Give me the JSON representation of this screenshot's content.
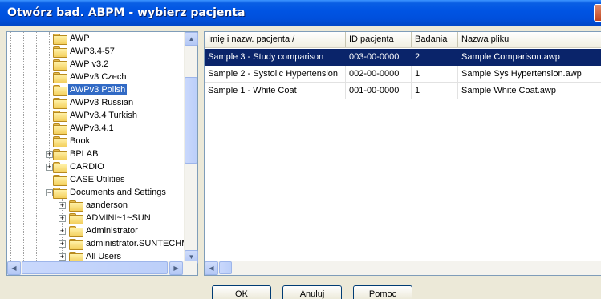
{
  "window": {
    "title": "Otwórz bad. ABPM - wybierz pacjenta"
  },
  "tree": {
    "items": [
      {
        "label": "AWP"
      },
      {
        "label": "AWP3.4-57"
      },
      {
        "label": "AWP v3.2"
      },
      {
        "label": "AWPv3 Czech"
      },
      {
        "label": "AWPv3 Polish",
        "selected": true
      },
      {
        "label": "AWPv3 Russian"
      },
      {
        "label": "AWPv3.4 Turkish"
      },
      {
        "label": "AWPv3.4.1"
      },
      {
        "label": "Book"
      },
      {
        "label": "BPLAB"
      },
      {
        "label": "CARDIO"
      },
      {
        "label": "CASE Utilities"
      },
      {
        "label": "Documents and Settings"
      },
      {
        "label": "aanderson"
      },
      {
        "label": "ADMINI~1~SUN"
      },
      {
        "label": "Administrator"
      },
      {
        "label": "administrator.SUNTECHM"
      },
      {
        "label": "All Users"
      }
    ],
    "expanders": {
      "plus": "+",
      "minus": "−"
    }
  },
  "list": {
    "columns": [
      "Imię i nazw. pacjenta /",
      "ID pacjenta",
      "Badania",
      "Nazwa pliku"
    ],
    "rows": [
      [
        "Sample 3 - Study comparison",
        "003-00-0000",
        "2",
        "Sample Comparison.awp"
      ],
      [
        "Sample 2 - Systolic Hypertension",
        "002-00-0000",
        "1",
        "Sample Sys Hypertension.awp"
      ],
      [
        "Sample 1 - White Coat",
        "001-00-0000",
        "1",
        "Sample White Coat.awp"
      ]
    ],
    "selected_row": 0
  },
  "scroll_glyphs": {
    "up": "▲",
    "down": "▼",
    "left": "◀",
    "right": "▶"
  },
  "buttons": {
    "ok": "OK",
    "cancel": "Anuluj",
    "help": "Pomoc"
  },
  "colors": {
    "title_bar": "#0054e3",
    "selection": "#316ac5",
    "row_selection": "#0a246a"
  }
}
